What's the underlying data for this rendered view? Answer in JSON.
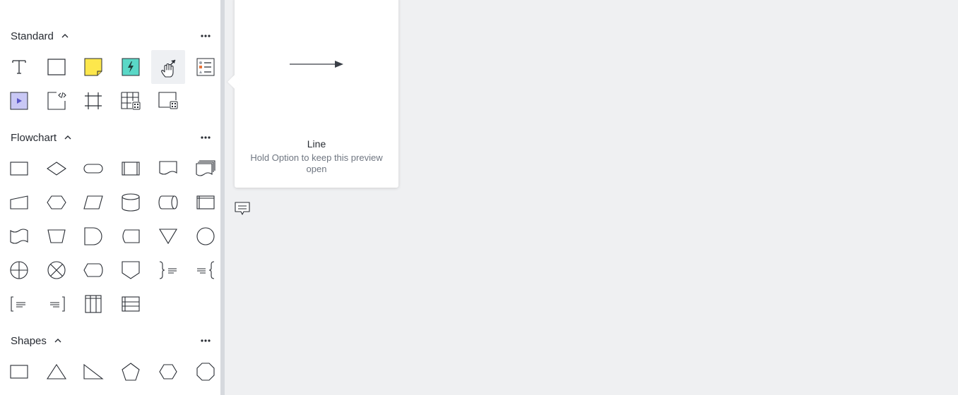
{
  "sidebar": {
    "sections": {
      "standard": {
        "title": "Standard"
      },
      "flowchart": {
        "title": "Flowchart"
      },
      "shapes": {
        "title": "Shapes"
      }
    }
  },
  "tooltip": {
    "title": "Line",
    "description": "Hold Option to keep this preview open"
  },
  "colors": {
    "sticky_yellow": "#fde74c",
    "action_teal": "#5ad8c7",
    "video_lavender": "#c9c8f5",
    "accent_pink": "#f7a1e0",
    "accent_periwinkle": "#a7a4ef"
  }
}
